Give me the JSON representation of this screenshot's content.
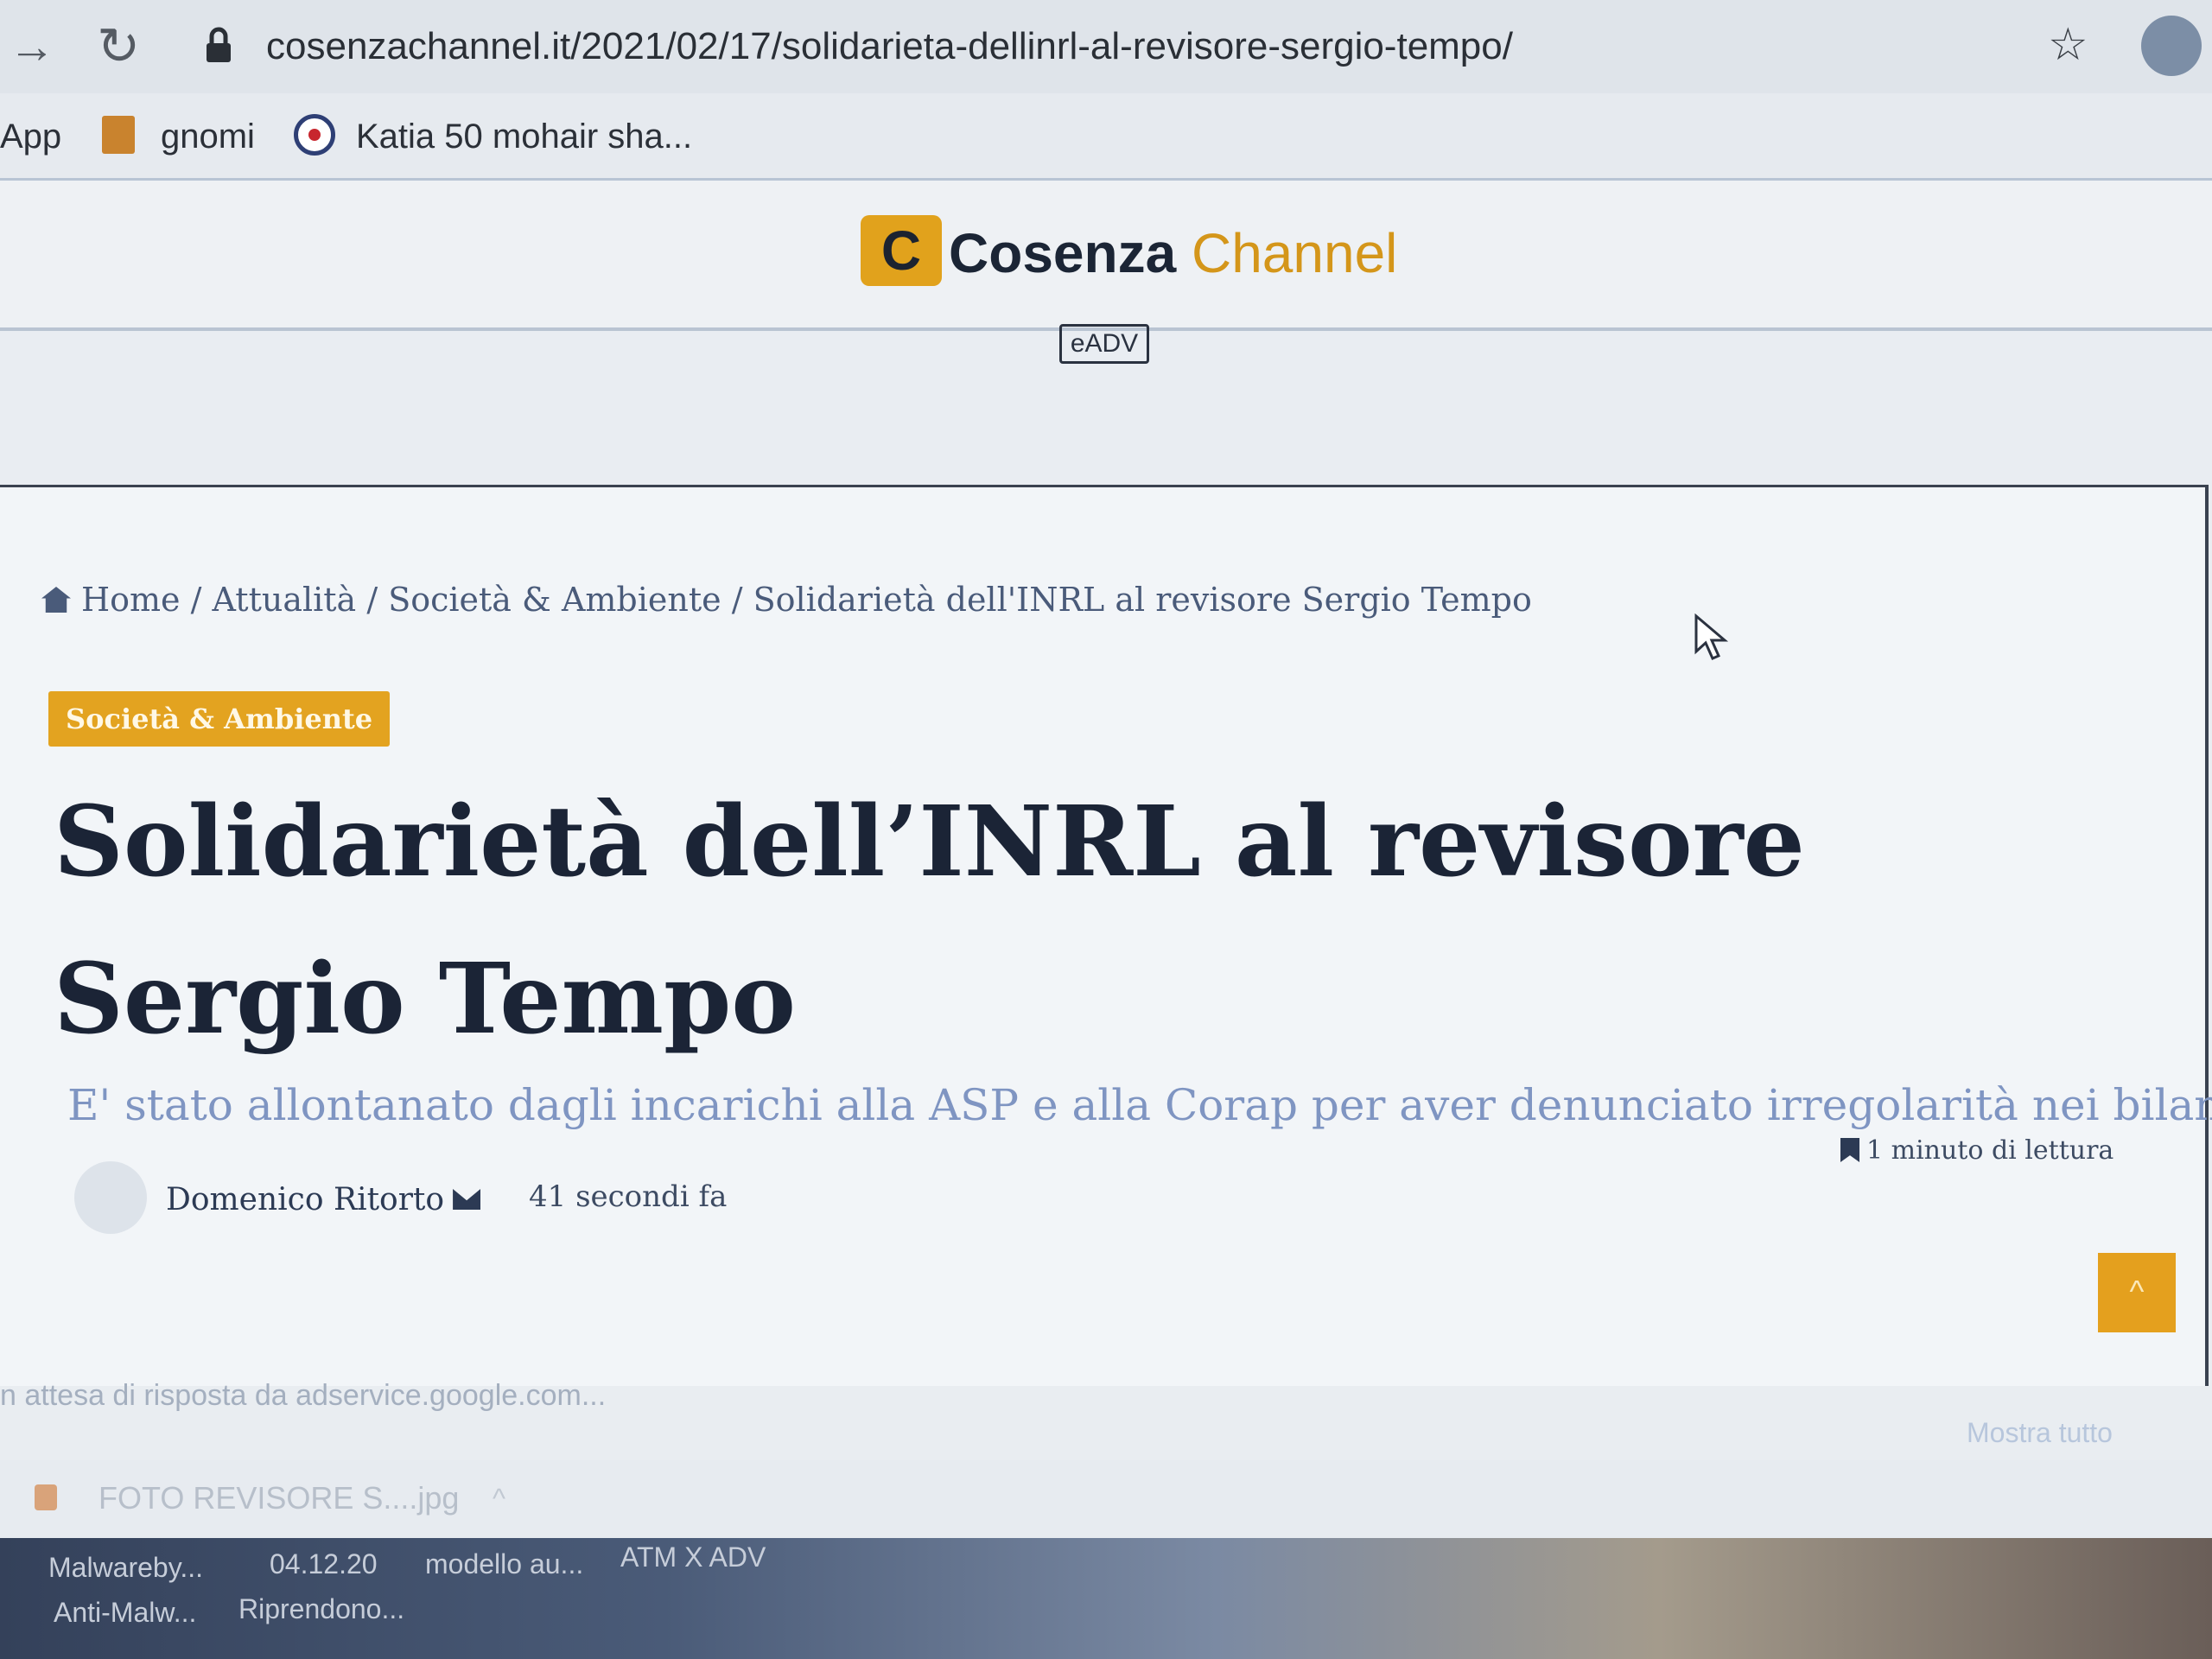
{
  "browser": {
    "url": "cosenzachannel.it/2021/02/17/solidarieta-dellinrl-al-revisore-sergio-tempo/",
    "bookmarks": [
      "App",
      "gnomi",
      "Katia 50 mohair sha..."
    ]
  },
  "site": {
    "logo_letter": "C",
    "logo_word1": "Cosenza",
    "logo_word2": "Channel",
    "adv_label": "eADV"
  },
  "article": {
    "breadcrumb": [
      "Home",
      "Attualità",
      "Società & Ambiente",
      "Solidarietà dell'INRL al revisore Sergio Tempo"
    ],
    "category_tag": "Società & Ambiente",
    "title": "Solidarietà dell’INRL al revisore Sergio Tempo",
    "subtitle": "E' stato allontanato dagli incarichi alla ASP e alla Corap per aver denunciato irregolarità nei bilanci",
    "author": "Domenico Ritorto",
    "time_ago": "41 secondi fa",
    "reading_time": "1 minuto di lettura"
  },
  "status_bar": {
    "text": "n attesa di risposta da adservice.google.com...",
    "show_all": "Mostra tutto",
    "download_file": "FOTO REVISORE S....jpg"
  },
  "taskbar": {
    "items": [
      "Malwareby...",
      "04.12.20",
      "modello au...",
      "ATM X ADV",
      "Anti-Malw...",
      "Riprendono..."
    ]
  },
  "colors": {
    "accent": "#e3a320",
    "title_text": "#1b2436",
    "subtitle_text": "#7f95c2"
  }
}
